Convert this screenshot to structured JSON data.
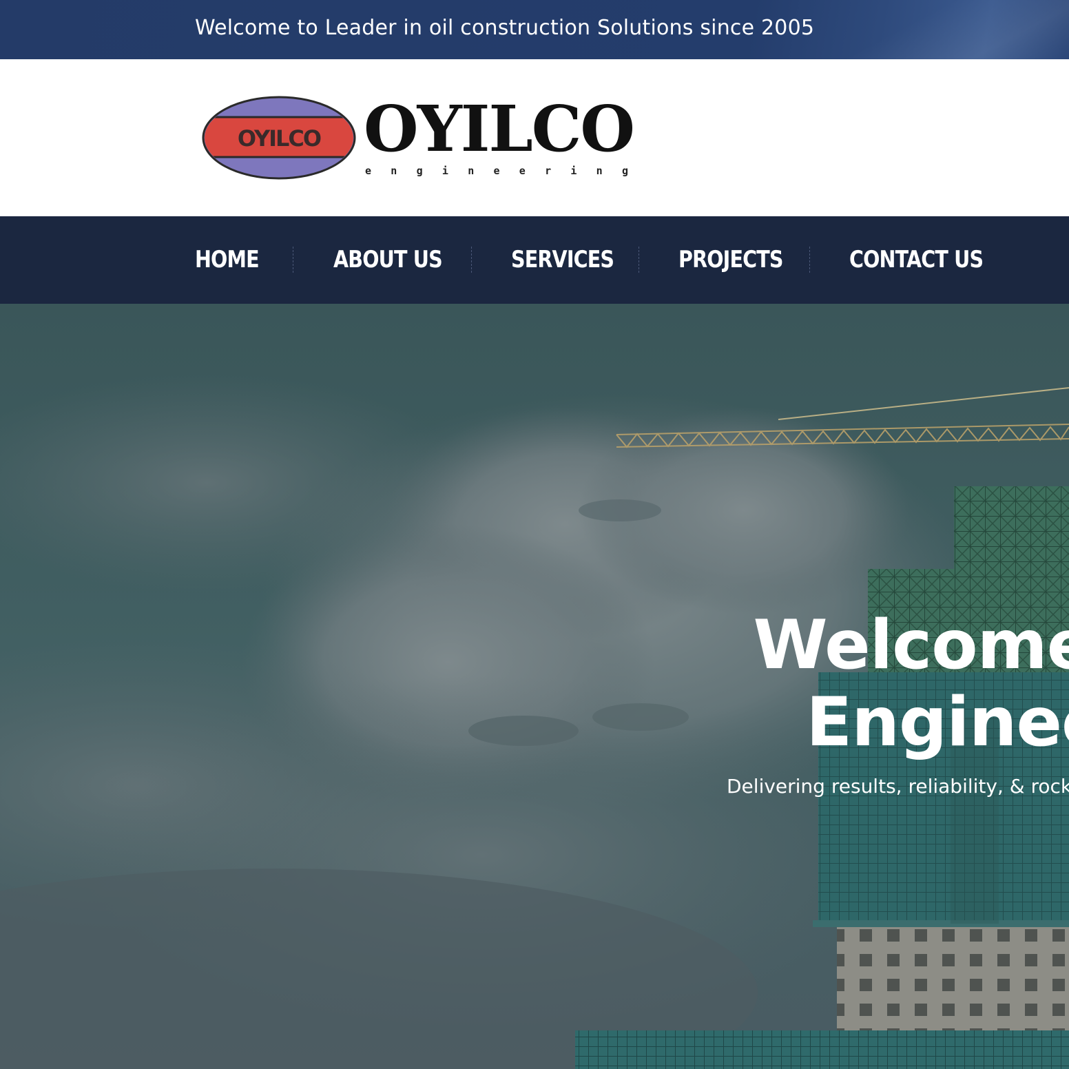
{
  "top_bar": {
    "welcome_text": "Welcome to Leader in oil construction Solutions since 2005"
  },
  "logo": {
    "badge_text": "OYILCO",
    "wordmark": "OYILCO",
    "tagline": "e n g i n e e r i n g",
    "colors": {
      "oval_outer": "#7e77bd",
      "oval_band": "#d9473f",
      "outline": "#2a2a2a",
      "wordmark": "#111111"
    }
  },
  "nav": {
    "items": [
      {
        "label": "HOME"
      },
      {
        "label": "ABOUT US"
      },
      {
        "label": "SERVICES"
      },
      {
        "label": "PROJECTS"
      },
      {
        "label": "CONTACT US"
      }
    ]
  },
  "hero": {
    "title_line1": "Welcome to",
    "title_line2": "Engineer",
    "subtitle": "Delivering results, reliability, & rock s"
  },
  "colors": {
    "top_bar": "#243d6c",
    "nav_bar": "#1b2740",
    "hero_overlay": "#3d5b60",
    "text_light": "#ffffff"
  }
}
